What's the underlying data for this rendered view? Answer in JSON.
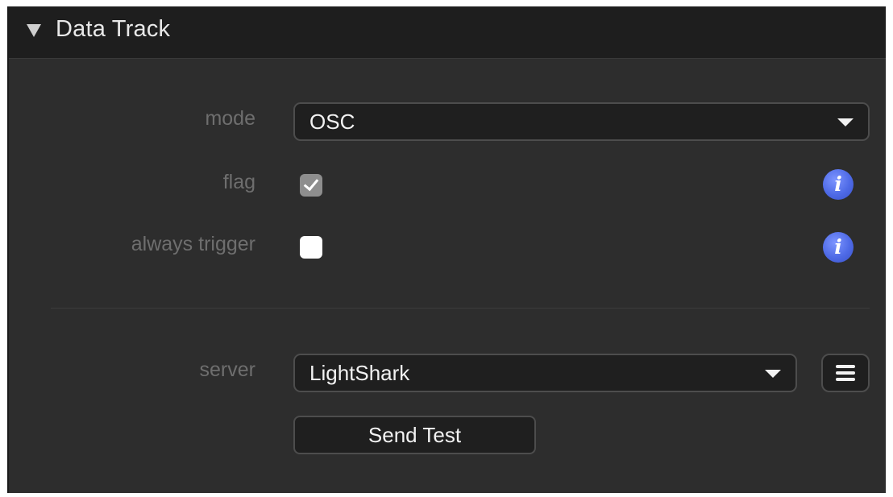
{
  "section": {
    "title": "Data Track",
    "expanded": true
  },
  "mode": {
    "label": "mode",
    "value": "OSC"
  },
  "flag": {
    "label": "flag",
    "checked": true
  },
  "always_trigger": {
    "label": "always trigger",
    "checked": false
  },
  "server": {
    "label": "server",
    "value": "LightShark"
  },
  "actions": {
    "send_test_label": "Send Test"
  },
  "icons": {
    "collapse": "triangle-down-icon",
    "info": "info-icon",
    "menu": "hamburger-menu-icon",
    "dropdown": "chevron-down-icon"
  },
  "colors": {
    "panel_bg": "#2d2d2d",
    "header_bg": "#1e1e1e",
    "field_bg": "#1f1f1f",
    "label_text": "#6e6e6e",
    "value_text": "#f2f2f2",
    "info_accent": "#4e6ae6"
  }
}
